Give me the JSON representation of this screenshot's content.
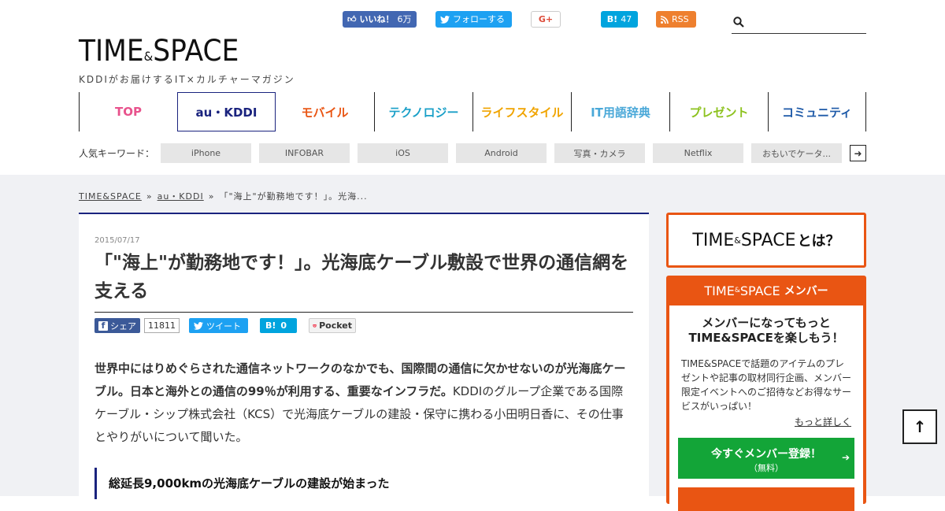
{
  "header": {
    "social": {
      "fb_like_label": "いいね！",
      "fb_like_count": "6万",
      "twitter_follow_label": "フォローする",
      "gplus_label": "G+",
      "hatena_label": "B!",
      "hatena_count": "47",
      "rss_label": "RSS"
    },
    "search": {
      "placeholder": ""
    },
    "logo": {
      "main_left": "TIME",
      "amp": "&",
      "main_right": "SPACE",
      "tagline": "KDDIがお届けするIT×カルチャーマガジン"
    }
  },
  "nav": {
    "items": [
      {
        "label": "TOP",
        "color": "#e8528c"
      },
      {
        "label": "au・KDDI",
        "color": "#1a237e"
      },
      {
        "label": "モバイル",
        "color": "#e95513"
      },
      {
        "label": "テクノロジー",
        "color": "#1ba0c8"
      },
      {
        "label": "ライフスタイル",
        "color": "#f0a400"
      },
      {
        "label": "IT用語辞典",
        "color": "#4aa8d8"
      },
      {
        "label": "プレゼント",
        "color": "#8dc21f"
      },
      {
        "label": "コミュニティ",
        "color": "#1e5aa8"
      }
    ]
  },
  "keywords": {
    "label": "人気キーワード：",
    "items": [
      "iPhone",
      "INFOBAR",
      "iOS",
      "Android",
      "写真・カメラ",
      "Netflix",
      "おもいでケータ..."
    ],
    "next_label": "➜"
  },
  "breadcrumb": {
    "items": [
      "TIME&SPACE",
      "au・KDDI",
      "「\"海上\"が勤務地です！」。光海..."
    ],
    "separator": "»"
  },
  "article": {
    "date": "2015/07/17",
    "title": "「\"海上\"が勤務地です！」。光海底ケーブル敷設で世界の通信網を支える",
    "share": {
      "fb_label": "シェア",
      "fb_count": "11811",
      "twitter_label": "ツイート",
      "hatena_label": "B!",
      "hatena_count": "0",
      "pocket_label": "Pocket"
    },
    "lead_bold": "世界中にはりめぐらされた通信ネットワークのなかでも、国際間の通信に欠かせないのが光海底ケーブル。日本と海外との通信の99％が利用する、重要なインフラだ。",
    "lead_rest": "KDDIのグループ企業である国際ケーブル・シップ株式会社（KCS）で光海底ケーブルの建設・保守に携わる小田明日香に、その仕事とやりがいについて聞いた。",
    "heading": "総延長9,000kmの光海底ケーブルの建設が始まった"
  },
  "sidebar": {
    "about": {
      "left": "TIME",
      "amp": "&",
      "right": "SPACE",
      "suffix": "とは？"
    },
    "member": {
      "head_left": "TIME",
      "head_amp": "&",
      "head_right": "SPACE",
      "head_suffix": "メンバー",
      "catch_line1": "メンバーになってもっと",
      "catch_line2": "TIME&SPACEを楽しもう！",
      "description": "TIME&SPACEで話題のアイテムのプレゼントや記事の取材同行企画、メンバー限定イベントへのご招待などお得なサービスがいっぱい！",
      "more_label": "もっと詳しく",
      "register_label": "今すぐメンバー登録！",
      "register_sub": "（無料）",
      "register_arrow": "➔"
    }
  },
  "to_top_label": "↑",
  "colors": {
    "accent": "#1a237e",
    "orange": "#e95513",
    "green": "#13a538",
    "bg": "#f0f1f4"
  }
}
